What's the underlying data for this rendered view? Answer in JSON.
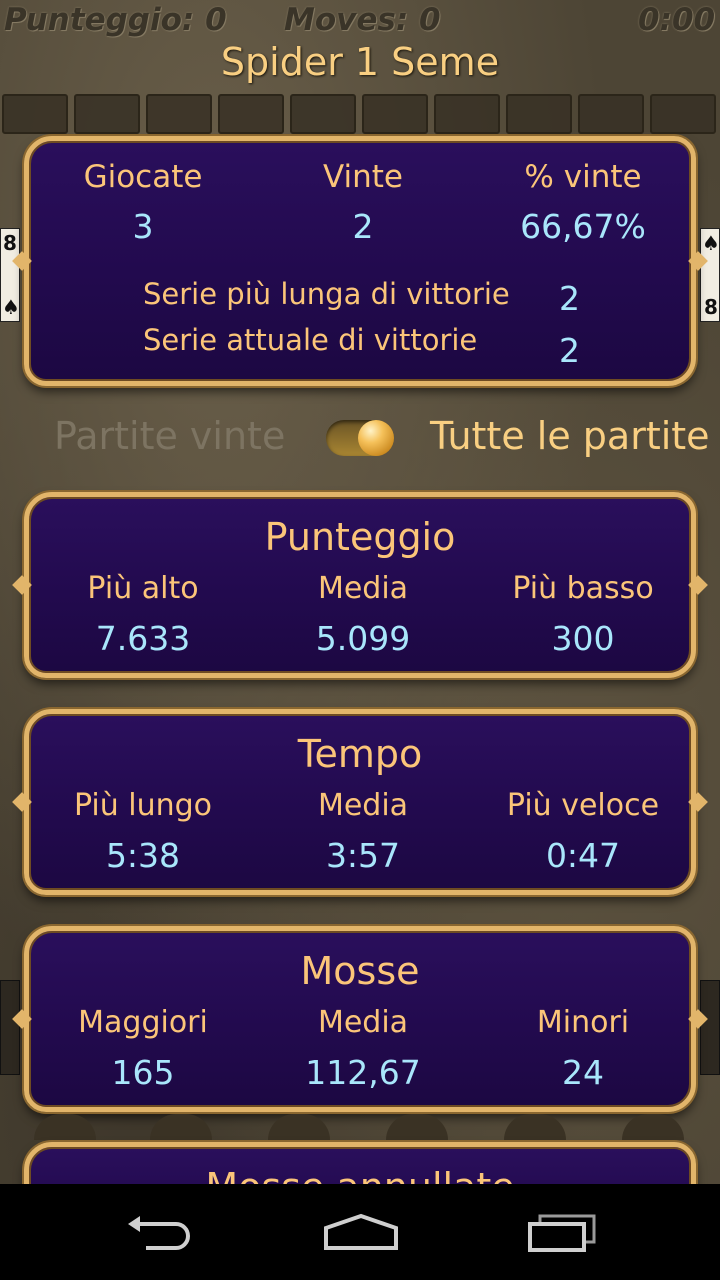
{
  "game_bar": {
    "score": "Punteggio: 0",
    "moves": "Moves: 0",
    "time": "0:00"
  },
  "title": "Spider 1 Seme",
  "summary": {
    "played_label": "Giocate",
    "played_value": "3",
    "won_label": "Vinte",
    "won_value": "2",
    "pct_label": "% vinte",
    "pct_value": "66,67%",
    "longest_streak_label": "Serie più lunga di vittorie",
    "longest_streak_value": "2",
    "current_streak_label": "Serie attuale di vittorie",
    "current_streak_value": "2"
  },
  "filter": {
    "left_label": "Partite vinte",
    "right_label": "Tutte le partite",
    "selected": "Tutte le partite"
  },
  "score": {
    "title": "Punteggio",
    "high_label": "Più alto",
    "high_value": "7.633",
    "avg_label": "Media",
    "avg_value": "5.099",
    "low_label": "Più basso",
    "low_value": "300"
  },
  "time": {
    "title": "Tempo",
    "long_label": "Più lungo",
    "long_value": "5:38",
    "avg_label": "Media",
    "avg_value": "3:57",
    "fast_label": "Più veloce",
    "fast_value": "0:47"
  },
  "moves": {
    "title": "Mosse",
    "max_label": "Maggiori",
    "max_value": "165",
    "avg_label": "Media",
    "avg_value": "112,67",
    "min_label": "Minori",
    "min_value": "24"
  },
  "undo": {
    "title": "Mosse annullate"
  },
  "cards": {
    "left_rank": "8",
    "left_suit": "♠",
    "right_rank": "8",
    "right_suit": "♠"
  },
  "colors": {
    "gold": "#fbc579",
    "value_blue": "#a9e6fb",
    "panel": "#2a0f5c",
    "border": "#e2b56a"
  }
}
